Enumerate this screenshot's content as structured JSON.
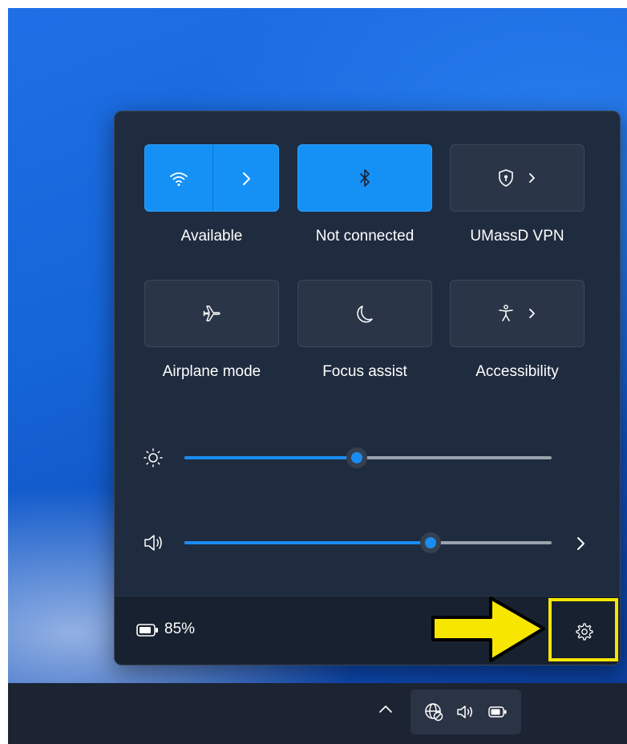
{
  "tiles": {
    "wifi": {
      "label": "Available",
      "state": "on",
      "icon": "wifi-icon"
    },
    "bluetooth": {
      "label": "Not connected",
      "state": "on",
      "icon": "bluetooth-icon"
    },
    "vpn": {
      "label": "UMassD VPN",
      "state": "off",
      "icon": "vpn-shield-icon"
    },
    "airplane": {
      "label": "Airplane mode",
      "state": "off",
      "icon": "airplane-icon"
    },
    "focus": {
      "label": "Focus assist",
      "state": "off",
      "icon": "moon-icon"
    },
    "accessibility": {
      "label": "Accessibility",
      "state": "off",
      "icon": "accessibility-icon"
    }
  },
  "sliders": {
    "brightness": {
      "icon": "brightness-icon",
      "level_percent": 47
    },
    "volume": {
      "icon": "speaker-icon",
      "level_percent": 67
    }
  },
  "footer": {
    "battery_label": "85%",
    "battery_icon": "battery-icon",
    "settings_icon": "gear-icon"
  },
  "annotation": {
    "arrow_color": "#f6e600",
    "box_color": "#f6e600"
  },
  "colors": {
    "accent": "#1591f5",
    "panel": "#1f2b3e",
    "taskbar": "#1c2433"
  }
}
